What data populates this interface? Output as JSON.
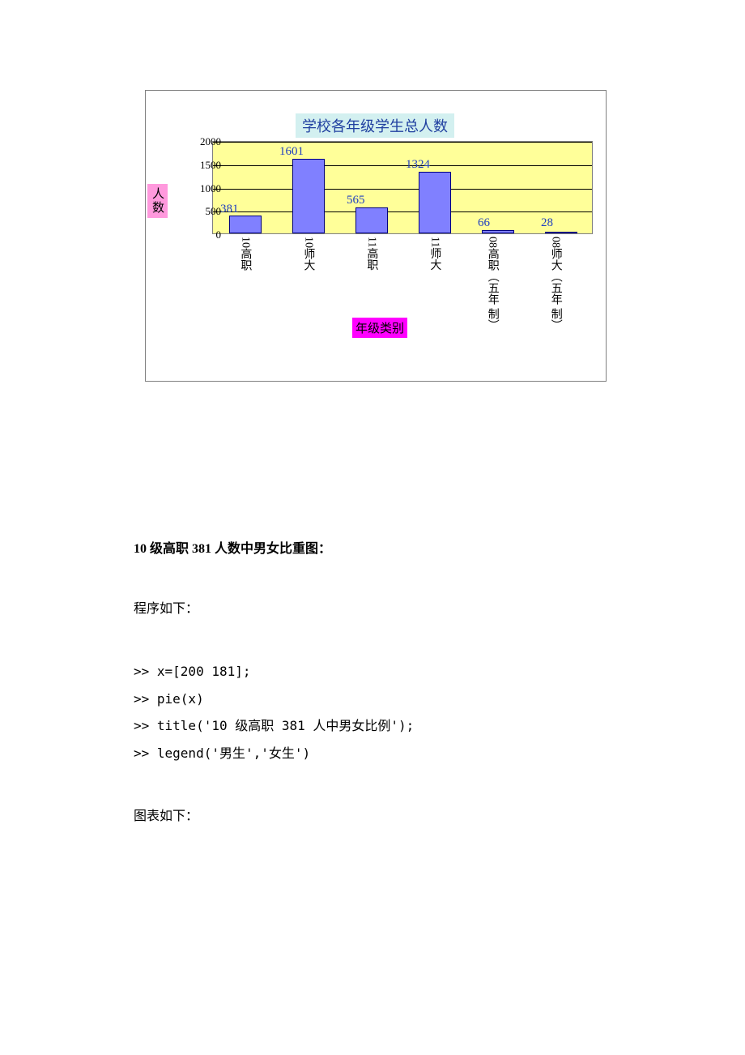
{
  "chart_data": {
    "type": "bar",
    "title": "学校各年级学生总人数",
    "ylabel": "人数",
    "xlabel": "年级类别",
    "categories": [
      "10高职",
      "10师大",
      "11高职",
      "11师大",
      "08高职（五年制）",
      "08师大（五年制）"
    ],
    "values": [
      381,
      1601,
      565,
      1324,
      66,
      28
    ],
    "ylim": [
      0,
      2000
    ],
    "yticks": [
      0,
      500,
      1000,
      1500,
      2000
    ]
  },
  "y_ticks": {
    "t0": "0",
    "t1": "500",
    "t2": "1000",
    "t3": "1500",
    "t4": "2000"
  },
  "bar_labels": {
    "b0": "381",
    "b1": "1601",
    "b2": "565",
    "b3": "1324",
    "b4": "66",
    "b5": "28"
  },
  "x_ticks": {
    "x0": "10高职",
    "x1": "10师大",
    "x2": "11高职",
    "x3": "11师大",
    "x4_l1": "08高职（五年",
    "x4_l2": "制）",
    "x5_l1": "08师大（五年",
    "x5_l2": "制）"
  },
  "document": {
    "heading": "10 级高职 381 人数中男女比重图：",
    "program_label": "程序如下：",
    "code_lines": {
      "l0": ">> x=[200 181];",
      "l1": ">> pie(x)",
      "l2": ">> title('10 级高职 381 人中男女比例');",
      "l3": ">> legend('男生','女生')"
    },
    "chart_label": "图表如下："
  }
}
